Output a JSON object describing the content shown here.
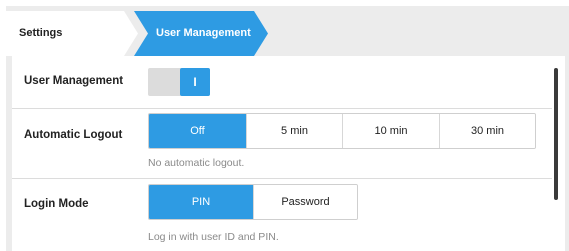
{
  "breadcrumb": {
    "items": [
      {
        "label": "Settings",
        "active": false
      },
      {
        "label": "User Management",
        "active": true
      }
    ]
  },
  "colors": {
    "accent": "#2e9be3",
    "background": "#ececec",
    "panel": "#ffffff"
  },
  "settings": {
    "user_management": {
      "label": "User Management",
      "toggle_state": true,
      "toggle_glyph": "I"
    },
    "automatic_logout": {
      "label": "Automatic Logout",
      "options": [
        "Off",
        "5 min",
        "10 min",
        "30 min"
      ],
      "selected": "Off",
      "helper": "No automatic logout."
    },
    "login_mode": {
      "label": "Login Mode",
      "options": [
        "PIN",
        "Password"
      ],
      "selected": "PIN",
      "helper": "Log in with user ID and PIN."
    }
  }
}
